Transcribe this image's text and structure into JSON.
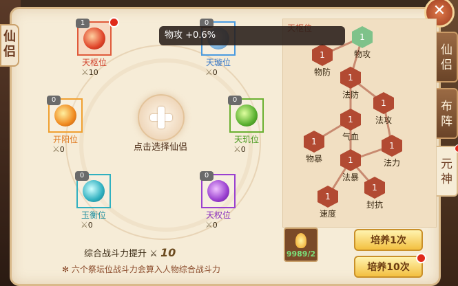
{
  "left_tab": {
    "label": "仙侣"
  },
  "right_tabs": [
    {
      "label": "仙侣"
    },
    {
      "label": "布阵"
    },
    {
      "label": "元神"
    }
  ],
  "tooltip": "物攻 +0.6%",
  "center": {
    "label": "点击选择仙侣"
  },
  "slots": [
    {
      "name": "天枢位",
      "level": "1",
      "power": "10",
      "color": "#e0452a"
    },
    {
      "name": "天璇位",
      "level": "0",
      "power": "0",
      "color": "#4a9be0"
    },
    {
      "name": "开阳位",
      "level": "0",
      "power": "0",
      "color": "#f08a20"
    },
    {
      "name": "天玑位",
      "level": "0",
      "power": "0",
      "color": "#5ab030"
    },
    {
      "name": "玉衡位",
      "level": "0",
      "power": "0",
      "color": "#30b0c0"
    },
    {
      "name": "天权位",
      "level": "0",
      "power": "0",
      "color": "#9a40d0"
    }
  ],
  "tree": {
    "title": "天枢位",
    "nodes": [
      {
        "label": "物攻",
        "level": "1"
      },
      {
        "label": "物防",
        "level": "1"
      },
      {
        "label": "法防",
        "level": "1"
      },
      {
        "label": "法攻",
        "level": "1"
      },
      {
        "label": "气血",
        "level": "1"
      },
      {
        "label": "物暴",
        "level": "1"
      },
      {
        "label": "法暴",
        "level": "1"
      },
      {
        "label": "法力",
        "level": "1"
      },
      {
        "label": "速度",
        "level": "1"
      },
      {
        "label": "封抗",
        "level": "1"
      }
    ]
  },
  "item": {
    "count": "9989/2"
  },
  "buttons": {
    "train1": "培养1次",
    "train10": "培养10次"
  },
  "summary": {
    "label": "综合战斗力提升",
    "value": "10"
  },
  "note": "六个祭坛位战斗力会算入人物综合战斗力"
}
